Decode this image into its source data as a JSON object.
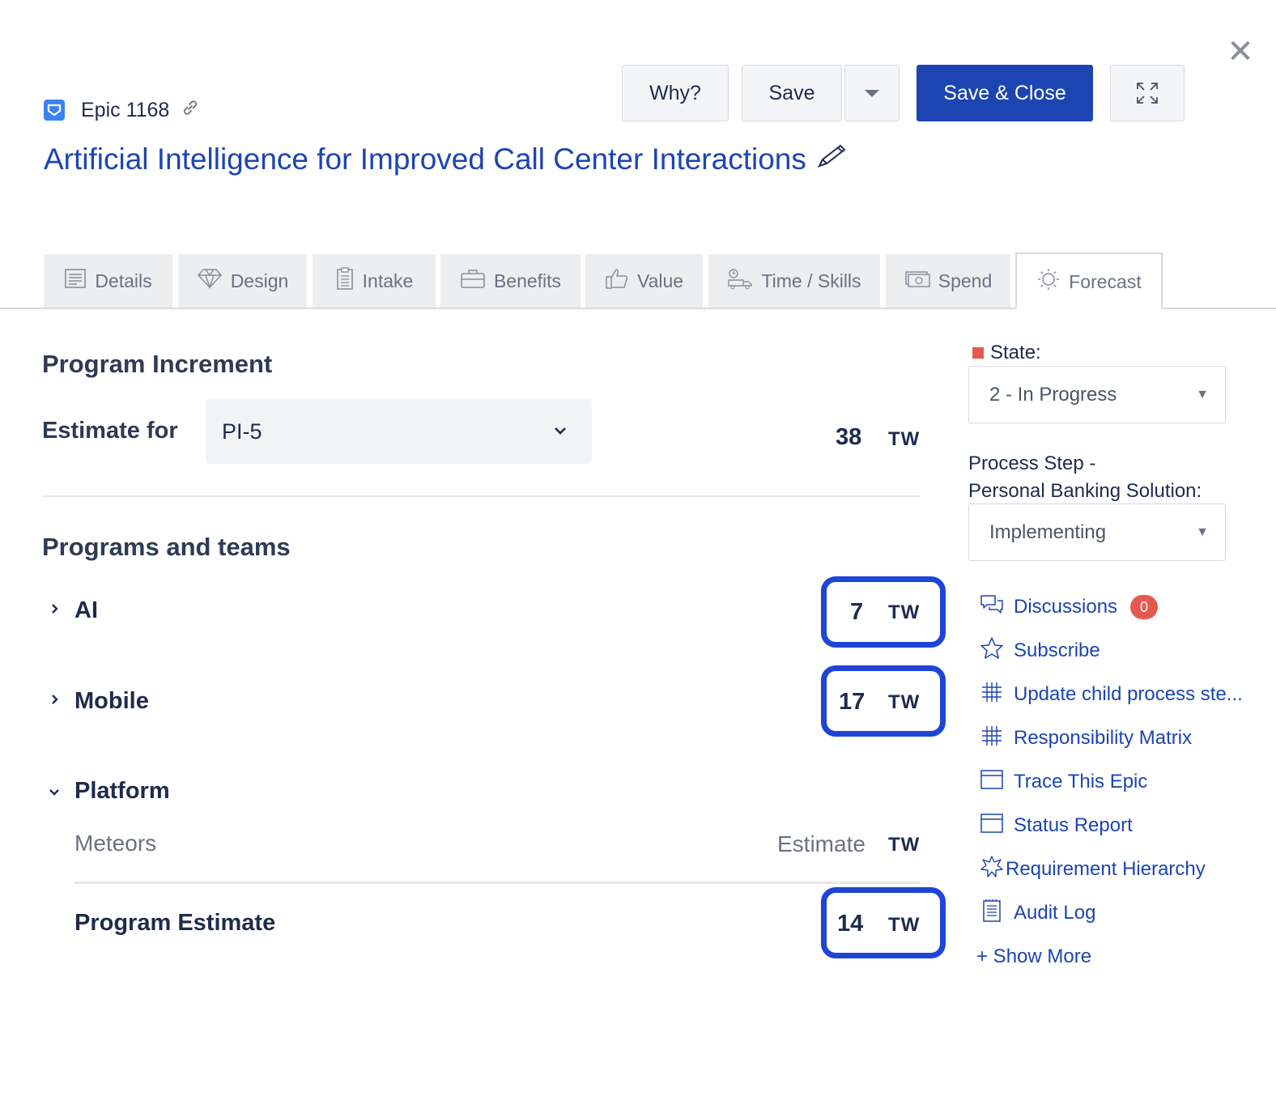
{
  "header": {
    "epic_id": "Epic 1168",
    "title": "Artificial Intelligence for Improved Call Center Interactions",
    "buttons": {
      "why": "Why?",
      "save": "Save",
      "save_close": "Save & Close"
    },
    "close_glyph": "✕"
  },
  "tabs": [
    {
      "label": "Details",
      "icon": "details-icon"
    },
    {
      "label": "Design",
      "icon": "diamond-icon"
    },
    {
      "label": "Intake",
      "icon": "clipboard-icon"
    },
    {
      "label": "Benefits",
      "icon": "briefcase-icon"
    },
    {
      "label": "Value",
      "icon": "thumbs-up-icon"
    },
    {
      "label": "Time / Skills",
      "icon": "truck-icon"
    },
    {
      "label": "Spend",
      "icon": "money-icon"
    },
    {
      "label": "Forecast",
      "icon": "sun-icon",
      "active": true
    }
  ],
  "program_increment": {
    "heading": "Program Increment",
    "estimate_label": "Estimate for",
    "selected": "PI-5",
    "total": "38",
    "unit": "TW"
  },
  "programs": {
    "heading": "Programs and teams",
    "rows": [
      {
        "name": "AI",
        "value": "7",
        "unit": "TW",
        "expanded": false
      },
      {
        "name": "Mobile",
        "value": "17",
        "unit": "TW",
        "expanded": false
      },
      {
        "name": "Platform",
        "expanded": true
      }
    ],
    "platform_team": {
      "name": "Meteors",
      "placeholder": "Estimate",
      "unit": "TW"
    },
    "program_estimate": {
      "label": "Program Estimate",
      "value": "14",
      "unit": "TW"
    }
  },
  "sidebar": {
    "state_label": "State:",
    "state_color": "#e55a4e",
    "state_value": "2 - In Progress",
    "process_step_label_1": "Process Step -",
    "process_step_label_2": "Personal Banking Solution:",
    "process_step_value": "Implementing",
    "actions": [
      {
        "label": "Discussions",
        "icon": "chat-icon",
        "badge": "0"
      },
      {
        "label": "Subscribe",
        "icon": "star-icon"
      },
      {
        "label": "Update child process ste...",
        "icon": "grid-icon"
      },
      {
        "label": "Responsibility Matrix",
        "icon": "grid-icon"
      },
      {
        "label": "Trace This Epic",
        "icon": "window-icon"
      },
      {
        "label": "Status Report",
        "icon": "window-icon"
      },
      {
        "label": "Requirement Hierarchy",
        "icon": "hierarchy-icon"
      },
      {
        "label": "Audit Log",
        "icon": "log-icon"
      }
    ],
    "show_more": "+ Show More"
  },
  "colors": {
    "primary": "#1d45b1",
    "highlight_border": "#1d45d6",
    "badge": "#e55a4e"
  }
}
